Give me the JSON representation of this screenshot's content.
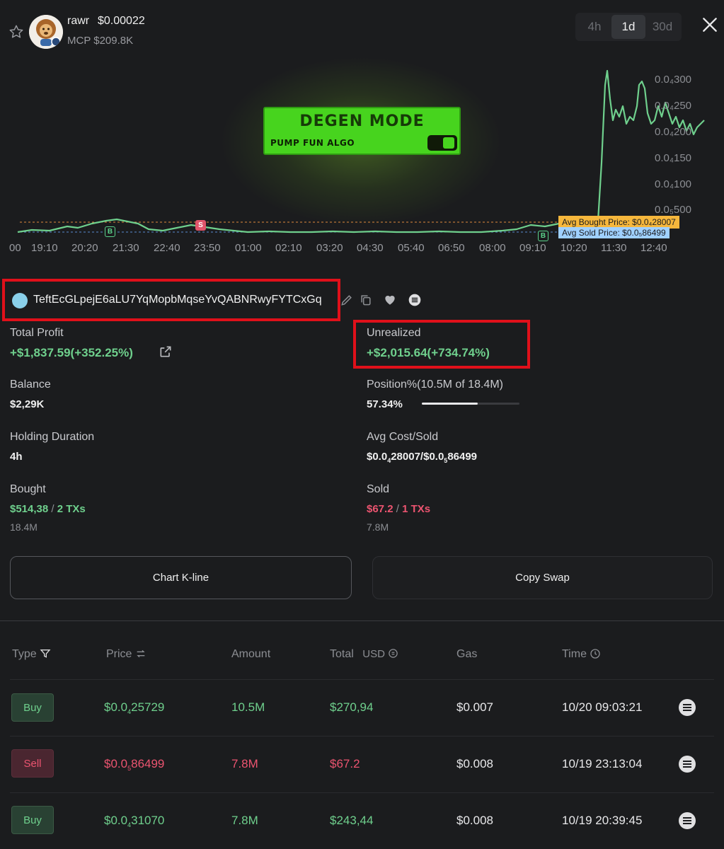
{
  "header": {
    "token_name": "rawr",
    "token_price": "$0.00022",
    "mcp": "MCP $209.8K",
    "timeframes": [
      "4h",
      "1d",
      "30d"
    ],
    "active_timeframe": "1d"
  },
  "banner": {
    "title": "DEGEN MODE",
    "subtitle": "PUMP FUN ALGO"
  },
  "chart": {
    "y_labels": [
      "0.0₄300",
      "0.0₄250",
      "0.0₄200",
      "0.0₄150",
      "0.0₄100",
      "0.0₅500"
    ],
    "x_labels": [
      "00",
      "19:10",
      "20:20",
      "21:30",
      "22:40",
      "23:50",
      "01:00",
      "02:10",
      "03:20",
      "04:30",
      "05:40",
      "06:50",
      "08:00",
      "09:10",
      "10:20",
      "11:30",
      "12:40"
    ],
    "avg_bought_tag": "Avg Bought Price: $0.0₄28007",
    "avg_sold_tag": "Avg Sold Price: $0.0₅86499",
    "line_color": "#6fd08d"
  },
  "wallet": {
    "address": "TeftEcGLpejE6aLU7YqMopbMqseYvQABNRwyFYTCxGq"
  },
  "stats": {
    "total_profit_label": "Total Profit",
    "total_profit_value": "+$1,837.59(+352.25%)",
    "unrealized_label": "Unrealized",
    "unrealized_value": "+$2,015.64(+734.74%)",
    "balance_label": "Balance",
    "balance_value": "$2,29K",
    "position_label": "Position%(10.5M of 18.4M)",
    "position_value": "57.34%",
    "position_fraction": 0.5734,
    "holding_label": "Holding Duration",
    "holding_value": "4h",
    "avgcost_label": "Avg Cost/Sold",
    "avgcost_a": "$0.0",
    "avgcost_a_sub": "4",
    "avgcost_b": "28007/$0.0",
    "avgcost_b_sub": "5",
    "avgcost_c": "86499",
    "bought_label": "Bought",
    "bought_value": "$514,38",
    "bought_sep": "/",
    "bought_txs": "2 TXs",
    "bought_amount": "18.4M",
    "sold_label": "Sold",
    "sold_value": "$67.2",
    "sold_sep": "/",
    "sold_txs": "1 TXs",
    "sold_amount": "7.8M"
  },
  "buttons": {
    "chart_kline": "Chart K-line",
    "copy_swap": "Copy Swap"
  },
  "table": {
    "headers": {
      "type": "Type",
      "price": "Price",
      "amount": "Amount",
      "total": "Total",
      "usd": "USD",
      "gas": "Gas",
      "time": "Time"
    },
    "rows": [
      {
        "type": "Buy",
        "price_main": "$0.0",
        "price_sub": "4",
        "price_rest": "25729",
        "amount": "10.5M",
        "total": "$270,94",
        "gas": "$0.007",
        "time": "10/20 09:03:21"
      },
      {
        "type": "Sell",
        "price_main": "$0.0",
        "price_sub": "5",
        "price_rest": "86499",
        "amount": "7.8M",
        "total": "$67.2",
        "gas": "$0.008",
        "time": "10/19 23:13:04"
      },
      {
        "type": "Buy",
        "price_main": "$0.0",
        "price_sub": "4",
        "price_rest": "31070",
        "amount": "7.8M",
        "total": "$243,44",
        "gas": "$0.008",
        "time": "10/19 20:39:45"
      }
    ]
  }
}
